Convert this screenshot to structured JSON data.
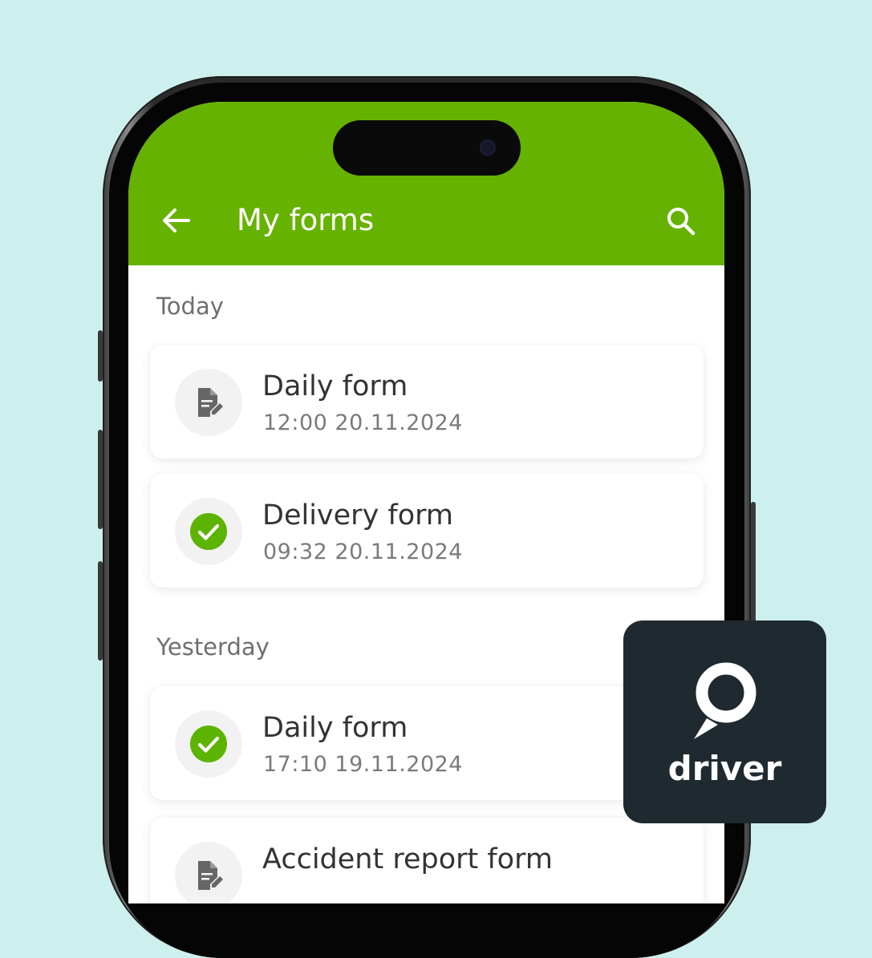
{
  "appbar": {
    "title": "My forms",
    "color": "#66b200",
    "back_icon": "arrow-left-icon",
    "search_icon": "search-icon"
  },
  "sections": [
    {
      "label": "Today",
      "items": [
        {
          "title": "Daily form",
          "datetime": "12:00 20.11.2024",
          "status_icon": "document-edit-icon"
        },
        {
          "title": "Delivery form",
          "datetime": "09:32 20.11.2024",
          "status_icon": "check-circle-icon"
        }
      ]
    },
    {
      "label": "Yesterday",
      "items": [
        {
          "title": "Daily form",
          "datetime": "17:10 19.11.2024",
          "status_icon": "check-circle-icon"
        },
        {
          "title": "Accident report form",
          "datetime": "",
          "status_icon": "document-edit-icon"
        }
      ]
    }
  ],
  "badge": {
    "wordmark": "driver",
    "icon": "map-pin-speech-icon",
    "background": "#1f2a30"
  },
  "colors": {
    "page_background": "#cdf0ee",
    "success": "#5cb300",
    "pending_icon": "#666666"
  }
}
